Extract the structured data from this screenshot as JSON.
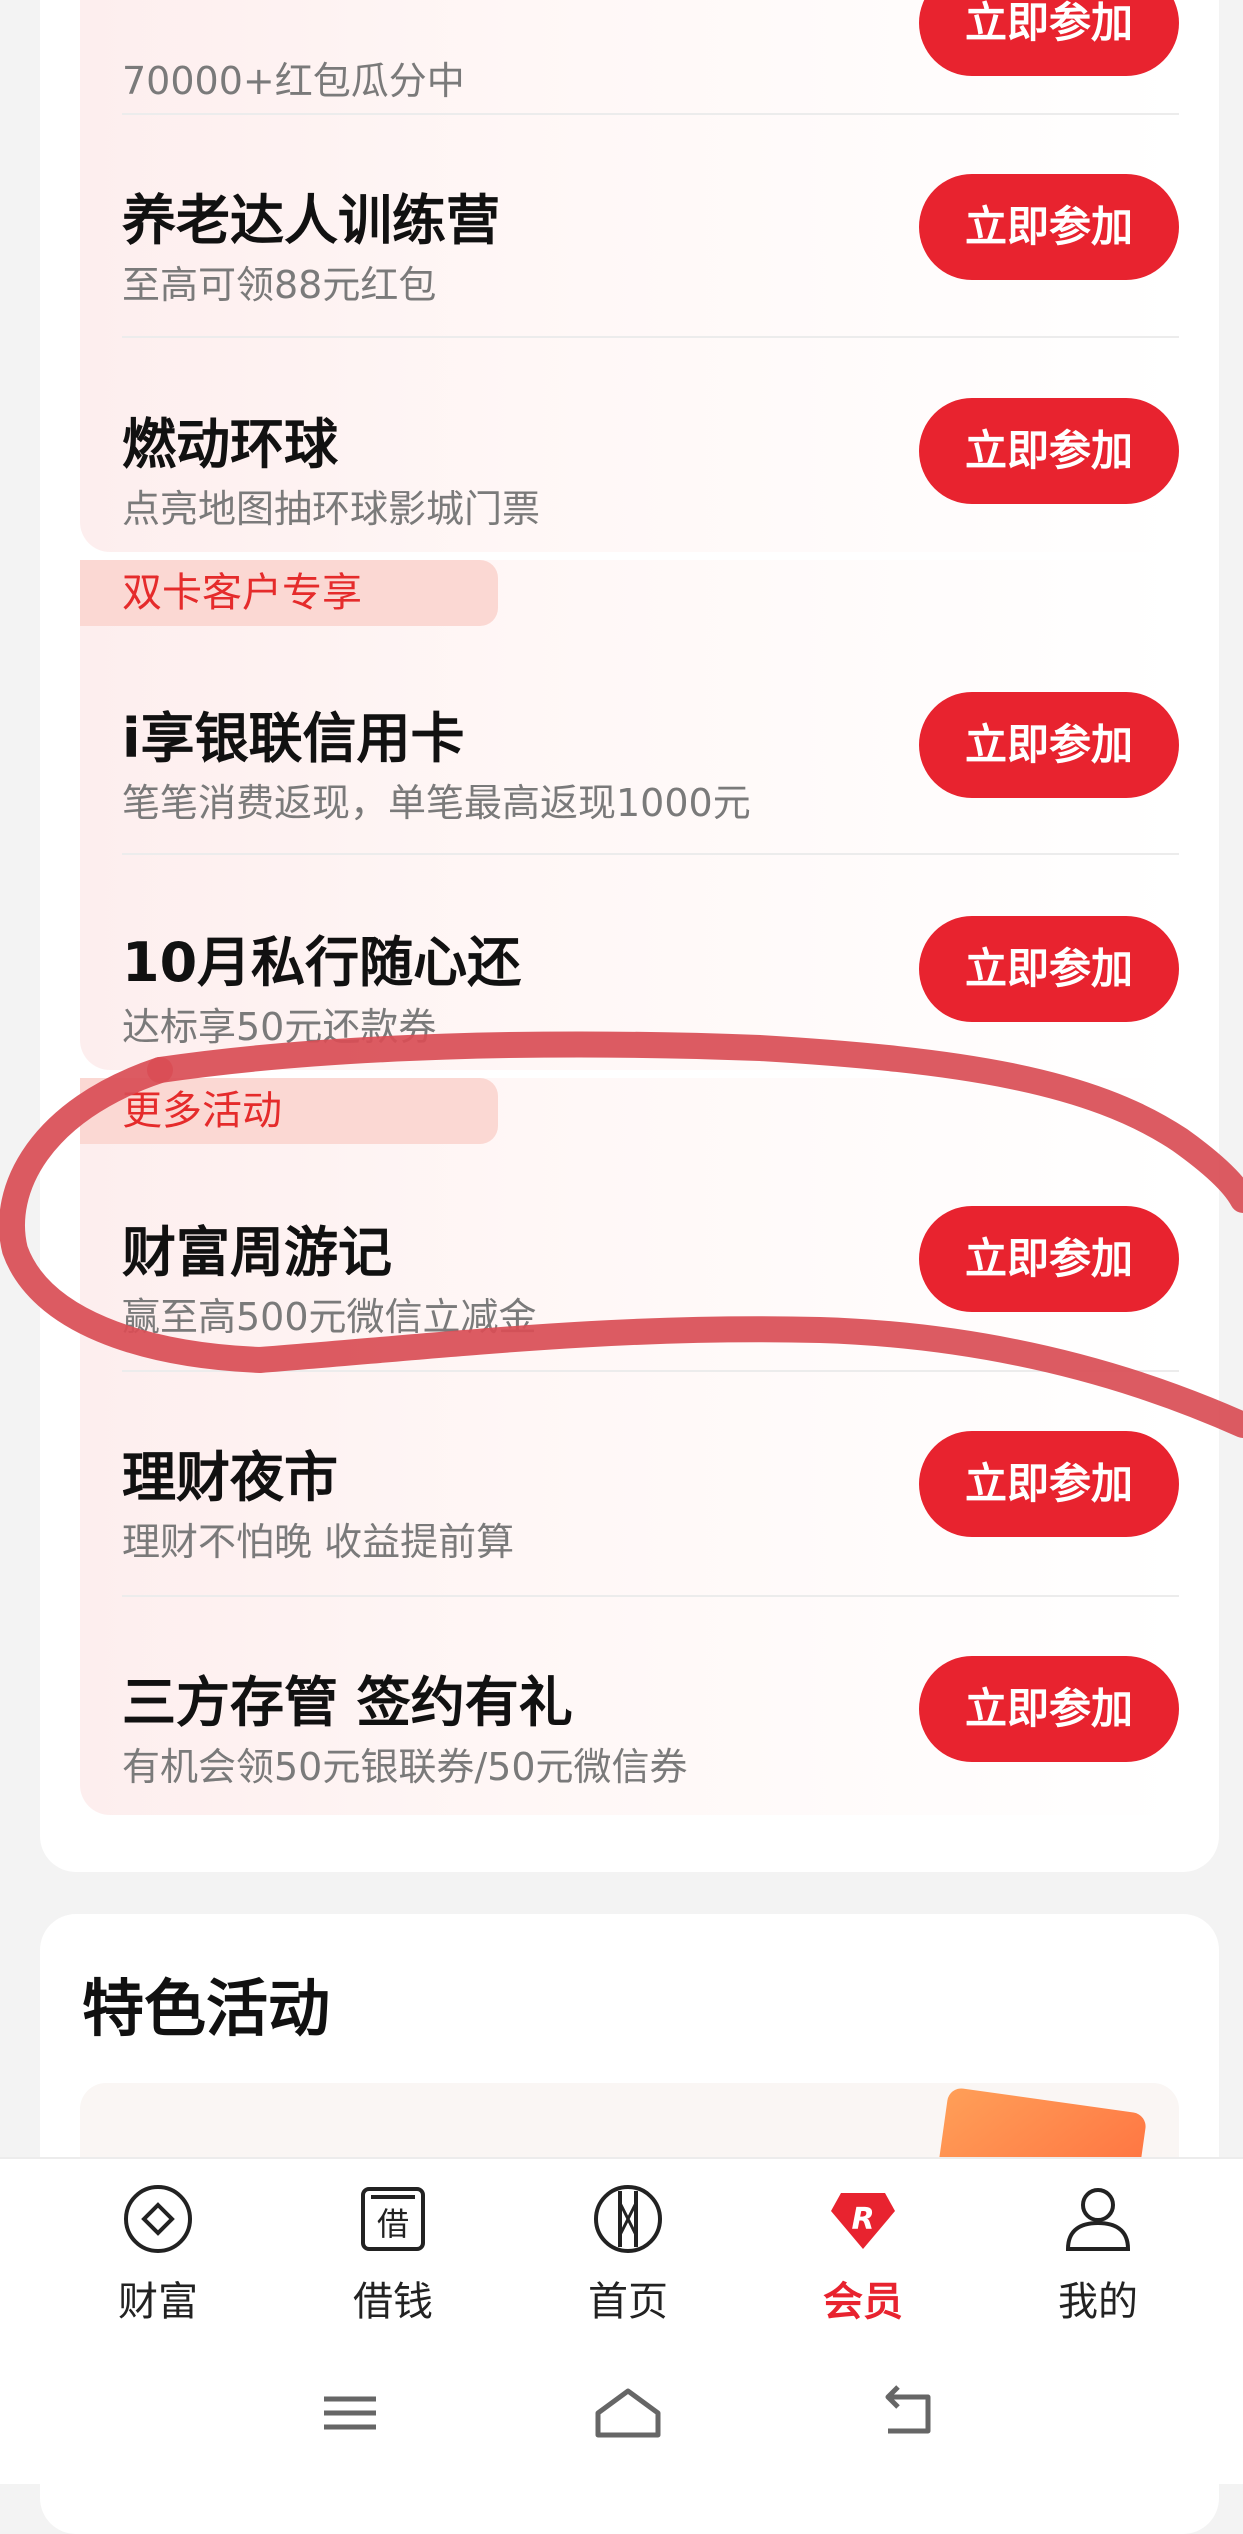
{
  "colors": {
    "accent": "#e8232f",
    "tag_bg": "#fbd8d3",
    "tag_text": "#e52b2b"
  },
  "rows_group1": [
    {
      "title": "",
      "subtitle": "70000+红包瓜分中",
      "button": "立即参加"
    },
    {
      "title": "养老达人训练营",
      "subtitle": "至高可领88元红包",
      "button": "立即参加"
    },
    {
      "title": "燃动环球",
      "subtitle": "点亮地图抽环球影城门票",
      "button": "立即参加"
    }
  ],
  "group2_label": "双卡客户专享",
  "rows_group2": [
    {
      "title": "i享银联信用卡",
      "subtitle": "笔笔消费返现，单笔最高返现1000元",
      "button": "立即参加"
    },
    {
      "title": "10月私行随心还",
      "subtitle": "达标享50元还款券",
      "button": "立即参加"
    }
  ],
  "group3_label": "更多活动",
  "rows_group3": [
    {
      "title": "财富周游记",
      "subtitle": "赢至高500元微信立减金",
      "button": "立即参加"
    },
    {
      "title": "理财夜市",
      "subtitle": "理财不怕晚 收益提前算",
      "button": "立即参加"
    },
    {
      "title": "三方存管 签约有礼",
      "subtitle": "有机会领50元银联券/50元微信券",
      "button": "立即参加"
    }
  ],
  "featured_section_title": "特色活动",
  "tabs": [
    {
      "label": "财富",
      "icon": "wealth-icon"
    },
    {
      "label": "借钱",
      "icon": "borrow-icon"
    },
    {
      "label": "首页",
      "icon": "home-logo-icon"
    },
    {
      "label": "会员",
      "icon": "member-icon",
      "active": true
    },
    {
      "label": "我的",
      "icon": "profile-icon"
    }
  ],
  "system_nav": [
    "menu-icon",
    "home-icon",
    "back-icon"
  ]
}
